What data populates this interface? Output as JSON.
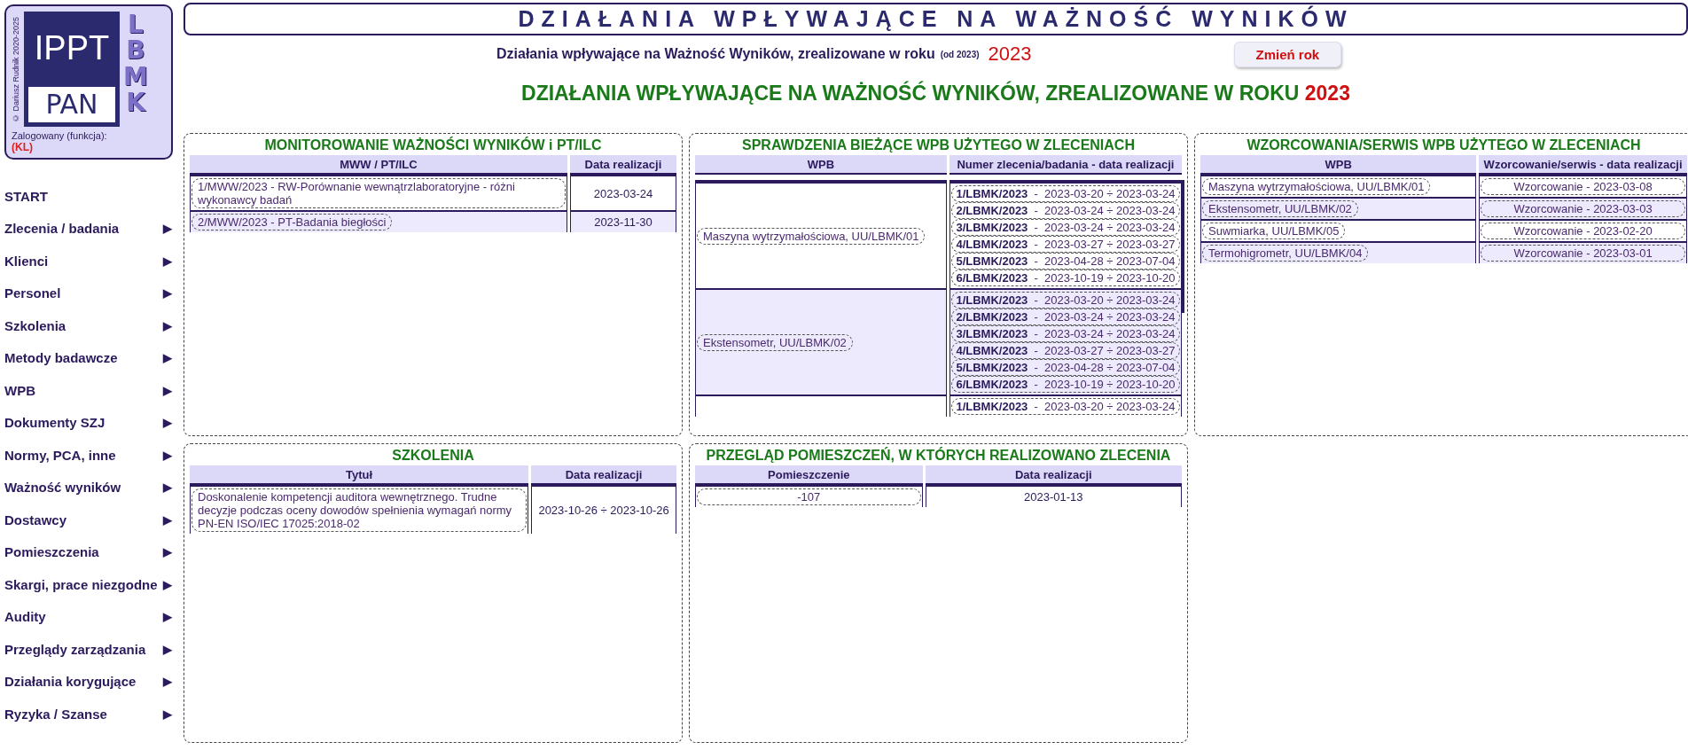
{
  "logo": {
    "copyright": "© Dariusz Rudnik 2020-2025",
    "top": "IPPT",
    "bottom": "PAN",
    "side": "LBMK",
    "login_label": "Zalogowany (funkcja):",
    "login_role": "(KL)"
  },
  "header": {
    "title": "DZIAŁANIA WPŁYWAJĄCE NA WAŻNOŚĆ WYNIKÓW",
    "subtitle": "Działania wpływające na Ważność Wyników, zrealizowane w roku",
    "since": "(od 2023)",
    "year": "2023",
    "button": "Zmień rok",
    "heading": "DZIAŁANIA WPŁYWAJĄCE NA WAŻNOŚĆ WYNIKÓW, ZREALIZOWANE W ROKU",
    "heading_year": "2023"
  },
  "menu": [
    {
      "label": "START"
    },
    {
      "label": "Zlecenia / badania",
      "arrow": "▶"
    },
    {
      "label": "Klienci",
      "arrow": "▶"
    },
    {
      "label": "Personel",
      "arrow": "▶"
    },
    {
      "label": "Szkolenia",
      "arrow": "▶"
    },
    {
      "label": "Metody badawcze",
      "arrow": "▶"
    },
    {
      "label": "WPB",
      "arrow": "▶"
    },
    {
      "label": "Dokumenty SZJ",
      "arrow": "▶"
    },
    {
      "label": "Normy, PCA, inne",
      "arrow": "▶"
    },
    {
      "label": "Ważność wyników",
      "arrow": "▶"
    },
    {
      "label": "Dostawcy",
      "arrow": "▶"
    },
    {
      "label": "Pomieszczenia",
      "arrow": "▶"
    },
    {
      "label": "Skargi, prace niezgodne",
      "arrow": "▶"
    },
    {
      "label": "Audity",
      "arrow": "▶"
    },
    {
      "label": "Przeglądy zarządzania",
      "arrow": "▶"
    },
    {
      "label": "Działania korygujące",
      "arrow": "▶"
    },
    {
      "label": "Ryzyka / Szanse",
      "arrow": "▶"
    }
  ],
  "monitoring": {
    "title": "MONITOROWANIE WAŻNOŚCI WYNIKÓW i PT/ILC",
    "columns": [
      "MWW / PT/ILC",
      "Data realizacji"
    ],
    "rows": [
      {
        "name": "1/MWW/2023 - RW-Porównanie wewnątrzlaboratoryjne - różni wykonawcy badań",
        "date": "2023-03-24"
      },
      {
        "name": "2/MWW/2023 - PT-Badania biegłości",
        "date": "2023-11-30"
      }
    ]
  },
  "checks": {
    "title": "SPRAWDZENIA BIEŻĄCE WPB UŻYTEGO W ZLECENIACH",
    "columns": [
      "WPB",
      "Numer zlecenia/badania - data realizacji"
    ],
    "groups": [
      {
        "wpb": "Maszyna wytrzymałościowa, UU/LBMK/01",
        "orders": [
          "**1/LBMK/2023**  -  2023-03-20 ÷ 2023-03-24",
          "**2/LBMK/2023**  -  2023-03-24 ÷ 2023-03-24",
          "**3/LBMK/2023**  -  2023-03-24 ÷ 2023-03-24",
          "**4/LBMK/2023**  -  2023-03-27 ÷ 2023-03-27",
          "**5/LBMK/2023**  -  2023-04-28 ÷ 2023-07-04",
          "**6/LBMK/2023**  -  2023-10-19 ÷ 2023-10-20"
        ]
      },
      {
        "wpb": "Ekstensometr, UU/LBMK/02",
        "orders": [
          "**1/LBMK/2023**  -  2023-03-20 ÷ 2023-03-24",
          "**2/LBMK/2023**  -  2023-03-24 ÷ 2023-03-24",
          "**3/LBMK/2023**  -  2023-03-24 ÷ 2023-03-24",
          "**4/LBMK/2023**  -  2023-03-27 ÷ 2023-03-27",
          "**5/LBMK/2023**  -  2023-04-28 ÷ 2023-07-04",
          "**6/LBMK/2023**  -  2023-10-19 ÷ 2023-10-20"
        ]
      },
      {
        "orders": [
          "**1/LBMK/2023**  -  2023-03-20 ÷ 2023-03-24"
        ]
      }
    ]
  },
  "calibrations": {
    "title": "WZORCOWANIA/SERWIS WPB UŻYTEGO W ZLECENIACH",
    "columns": [
      "WPB",
      "Wzorcowanie/serwis - data realizacji"
    ],
    "rows": [
      {
        "wpb": "Maszyna wytrzymałościowa, UU/LBMK/01",
        "event": "Wzorcowanie  -  2023-03-08"
      },
      {
        "wpb": "Ekstensometr, UU/LBMK/02",
        "event": "Wzorcowanie  -  2023-03-03"
      },
      {
        "wpb": "Suwmiarka, UU/LBMK/05",
        "event": "Wzorcowanie  -  2023-02-20"
      },
      {
        "wpb": "Termohigrometr, UU/LBMK/04",
        "event": "Wzorcowanie  -  2023-03-01"
      }
    ]
  },
  "trainings": {
    "title": "SZKOLENIA",
    "columns": [
      "Tytuł",
      "Data realizacji"
    ],
    "rows": [
      {
        "name": "Doskonalenie kompetencji auditora wewnętrznego. Trudne decyzje podczas oceny dowodów spełnienia wymagań normy PN-EN ISO/IEC 17025:2018-02",
        "date": "2023-10-26 ÷ 2023-10-26"
      }
    ]
  },
  "rooms": {
    "title": "PRZEGLĄD POMIESZCZEŃ, W KTÓRYCH REALIZOWANO ZLECENIA",
    "columns": [
      "Pomieszczenie",
      "Data realizacji"
    ],
    "rows": [
      {
        "name": "-107",
        "date": "2023-01-13"
      }
    ]
  }
}
